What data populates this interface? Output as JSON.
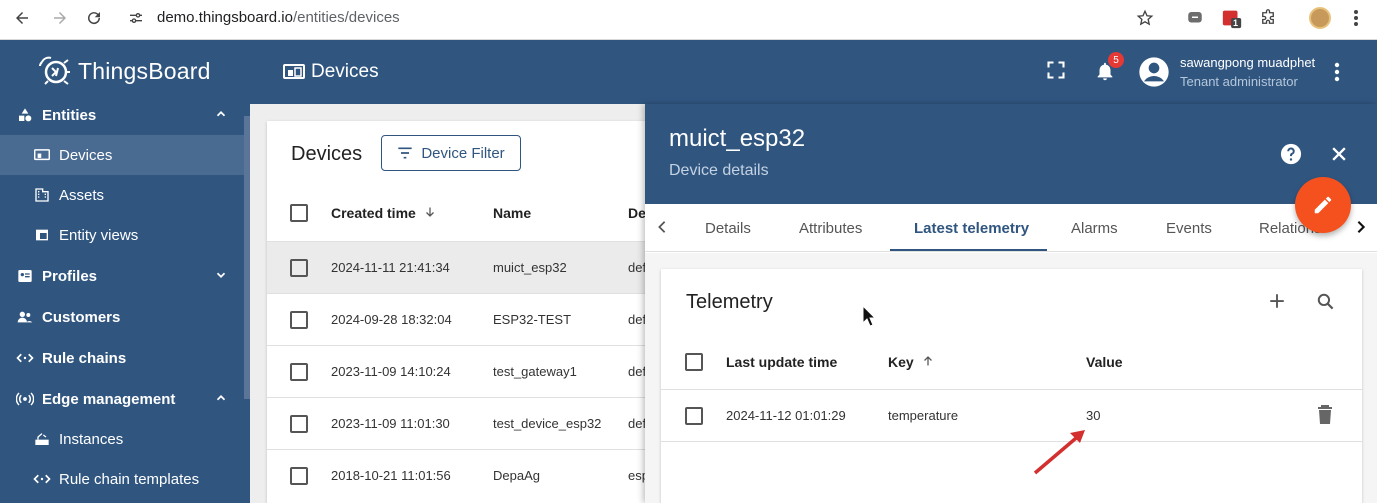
{
  "browser": {
    "url_host": "demo.thingsboard.io",
    "url_path": "/entities/devices",
    "ext_badge": "1"
  },
  "app": {
    "logo_text": "ThingsBoard",
    "page_title": "Devices",
    "notification_count": "5",
    "user_name": "sawangpong muadphet",
    "user_role": "Tenant administrator"
  },
  "sidebar": {
    "items": [
      {
        "label": "Entities",
        "icon": "entities-icon",
        "level": "top",
        "chevron": "up"
      },
      {
        "label": "Devices",
        "icon": "devices-icon",
        "level": "sub",
        "active": true
      },
      {
        "label": "Assets",
        "icon": "assets-icon",
        "level": "sub"
      },
      {
        "label": "Entity views",
        "icon": "entity-views-icon",
        "level": "sub"
      },
      {
        "label": "Profiles",
        "icon": "profiles-icon",
        "level": "top",
        "chevron": "down"
      },
      {
        "label": "Customers",
        "icon": "customers-icon",
        "level": "top"
      },
      {
        "label": "Rule chains",
        "icon": "rule-chains-icon",
        "level": "top"
      },
      {
        "label": "Edge management",
        "icon": "edge-icon",
        "level": "top",
        "chevron": "up"
      },
      {
        "label": "Instances",
        "icon": "instances-icon",
        "level": "sub"
      },
      {
        "label": "Rule chain templates",
        "icon": "rule-templates-icon",
        "level": "sub"
      }
    ]
  },
  "devices": {
    "title": "Devices",
    "filter_label": "Device Filter",
    "columns": [
      "Created time",
      "Name",
      "De"
    ],
    "rows": [
      {
        "created": "2024-11-11 21:41:34",
        "name": "muict_esp32",
        "profile": "def"
      },
      {
        "created": "2024-09-28 18:32:04",
        "name": "ESP32-TEST",
        "profile": "def"
      },
      {
        "created": "2023-11-09 14:10:24",
        "name": "test_gateway1",
        "profile": "def"
      },
      {
        "created": "2023-11-09 11:01:30",
        "name": "test_device_esp32",
        "profile": "def"
      },
      {
        "created": "2018-10-21 11:01:56",
        "name": "DepaAg",
        "profile": "esp"
      }
    ]
  },
  "details": {
    "device_name": "muict_esp32",
    "subtitle": "Device details",
    "tabs": [
      "Details",
      "Attributes",
      "Latest telemetry",
      "Alarms",
      "Events",
      "Relations"
    ],
    "active_tab": "Latest telemetry"
  },
  "telemetry": {
    "title": "Telemetry",
    "columns": [
      "Last update time",
      "Key",
      "Value"
    ],
    "rows": [
      {
        "time": "2024-11-12 01:01:29",
        "key": "temperature",
        "value": "30"
      }
    ]
  },
  "colors": {
    "primary": "#305680",
    "accent": "#f4511e",
    "annotation_arrow": "#d32f2f"
  }
}
